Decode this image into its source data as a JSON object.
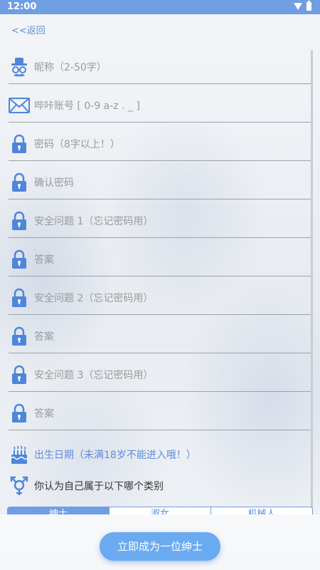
{
  "status_bar": {
    "time": "12:00"
  },
  "nav": {
    "back_label": "<<返回"
  },
  "form": {
    "nickname_placeholder": "昵称（2-50字）",
    "account_placeholder": "哔咔账号 [ 0-9 a-z . _ ]",
    "password_placeholder": "密码（8字以上！）",
    "confirm_password_placeholder": "确认密码",
    "question1_placeholder": "安全问题 1（忘记密码用）",
    "answer1_placeholder": "答案",
    "question2_placeholder": "安全问题 2（忘记密码用）",
    "answer2_placeholder": "答案",
    "question3_placeholder": "安全问题 3（忘记密码用）",
    "answer3_placeholder": "答案",
    "birthday_label": "出生日期（未满18岁不能进入哦！）",
    "gender_question": "你认为自己属于以下哪个类别",
    "gender_options": [
      "绅士",
      "淑女",
      "机械人"
    ]
  },
  "submit_label": "立即成为一位绅士",
  "colors": {
    "accent": "#6f9ee3",
    "button": "#6aaaf0",
    "icon": "#4f86d9"
  }
}
